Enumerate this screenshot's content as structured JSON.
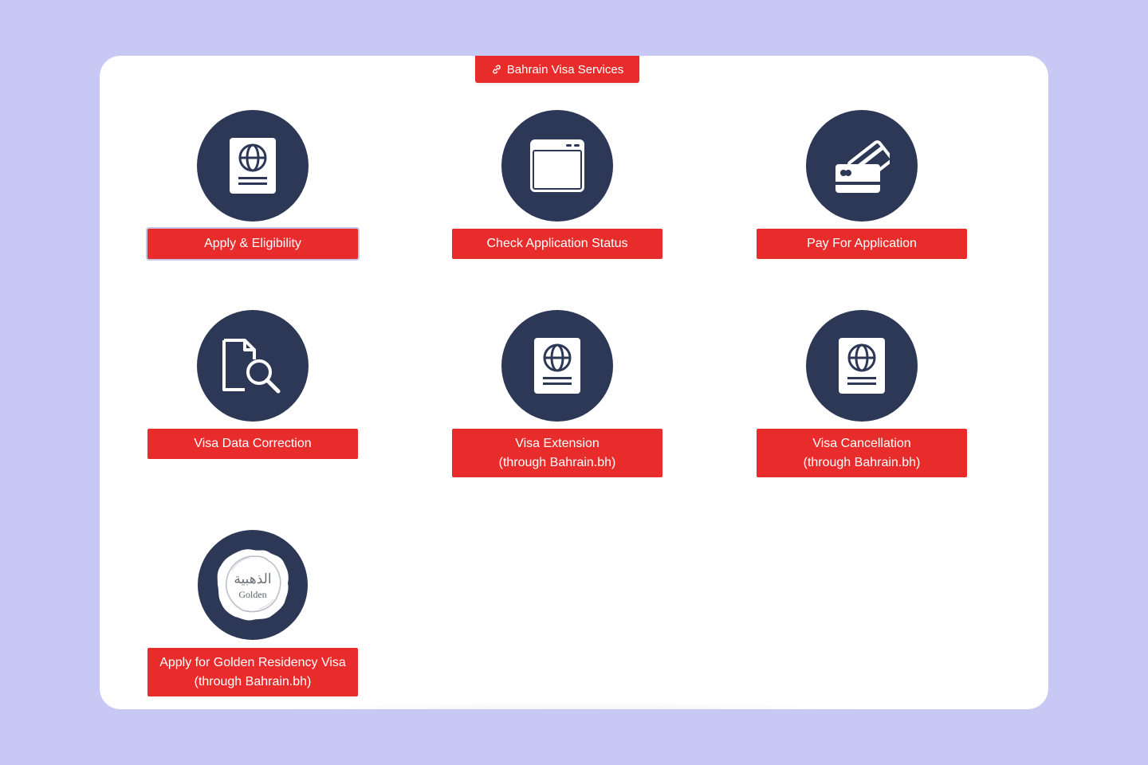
{
  "header": {
    "label": "Bahrain Visa Services",
    "icon": "link-icon"
  },
  "services": [
    {
      "id": "apply",
      "icon": "passport-icon",
      "line1": "Apply & Eligibility",
      "line2": ""
    },
    {
      "id": "status",
      "icon": "browser-window-icon",
      "line1": "Check Application Status",
      "line2": ""
    },
    {
      "id": "pay",
      "icon": "credit-cards-icon",
      "line1": "Pay For Application",
      "line2": ""
    },
    {
      "id": "correction",
      "icon": "document-search-icon",
      "line1": "Visa Data Correction",
      "line2": ""
    },
    {
      "id": "extension",
      "icon": "passport-icon",
      "line1": "Visa Extension",
      "line2": "(through Bahrain.bh)"
    },
    {
      "id": "cancellation",
      "icon": "passport-icon",
      "line1": "Visa Cancellation",
      "line2": "(through Bahrain.bh)"
    },
    {
      "id": "golden",
      "icon": "golden-seal-icon",
      "line1": "Apply for Golden Residency Visa",
      "line2": "(through Bahrain.bh)",
      "seal_text_ar": "الذهبية",
      "seal_text_en": "Golden"
    }
  ],
  "colors": {
    "background": "#c8c8f4",
    "card": "#ffffff",
    "button": "#e82c2c",
    "icon_circle": "#2d3856"
  }
}
